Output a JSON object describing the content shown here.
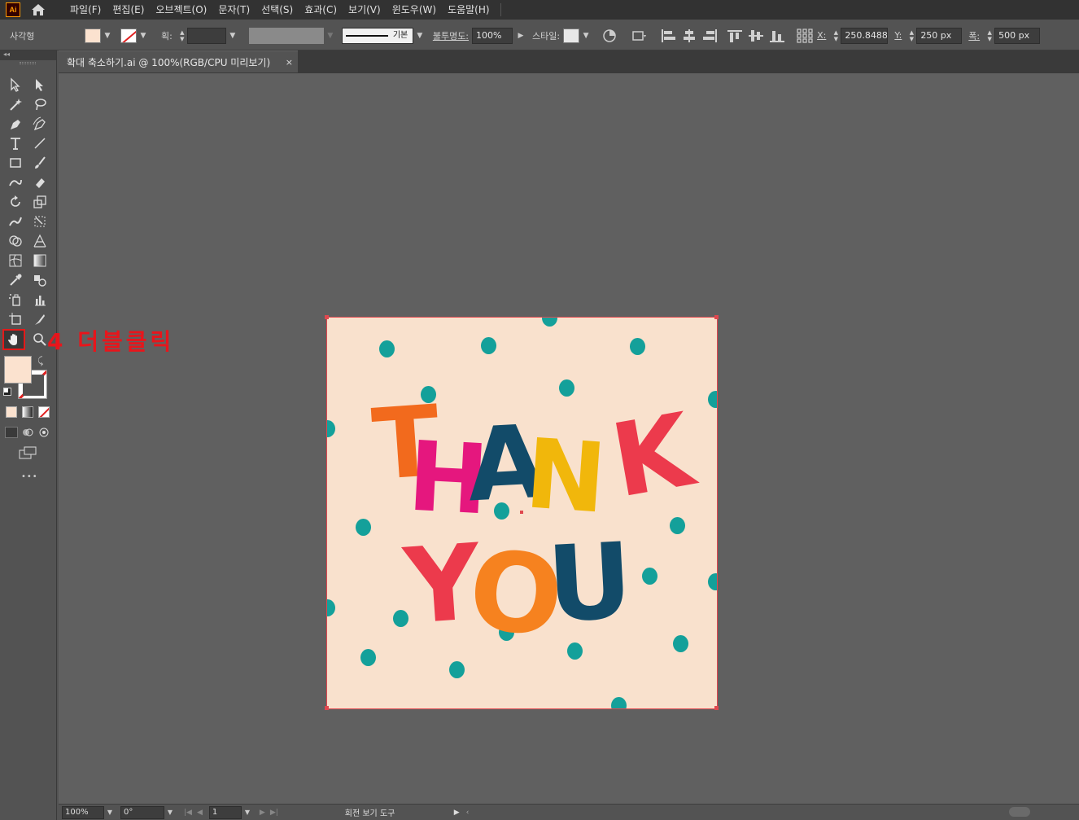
{
  "app": {
    "logo": "Ai"
  },
  "menu": {
    "items": [
      "파일(F)",
      "편집(E)",
      "오브젝트(O)",
      "문자(T)",
      "선택(S)",
      "효과(C)",
      "보기(V)",
      "윈도우(W)",
      "도움말(H)"
    ]
  },
  "control_bar": {
    "object_type": "사각형",
    "fill_color": "#fbe2cf",
    "stroke_label": "획:",
    "stroke_profile": "기본",
    "opacity_label": "불투명도:",
    "opacity_value": "100%",
    "style_label": "스타일:",
    "x_label": "X:",
    "x_value": "250.8488 p",
    "y_label": "Y:",
    "y_value": "250 px",
    "w_label": "폭:",
    "w_value": "500 px"
  },
  "document": {
    "tab_title": "확대 축소하기.ai @ 100%(RGB/CPU 미리보기)",
    "close_glyph": "×"
  },
  "artboard": {
    "line1": [
      "T",
      "H",
      "A",
      "N",
      "K"
    ],
    "line2": [
      "Y",
      "O",
      "U"
    ],
    "letter_colors": [
      "#f26a1d",
      "#e5177e",
      "#124b69",
      "#f1b70b",
      "#ec3a4c",
      "#ec3a4c",
      "#f6821f",
      "#124b69"
    ],
    "background": "#f9e1cd",
    "dot_color": "#14a09a"
  },
  "annotation": {
    "text": "4 더블클릭"
  },
  "status_bar": {
    "zoom": "100%",
    "rotation": "0°",
    "artboard_num": "1",
    "tool_name": "회전 보기 도구"
  },
  "tools": {
    "more_label": "•••"
  }
}
